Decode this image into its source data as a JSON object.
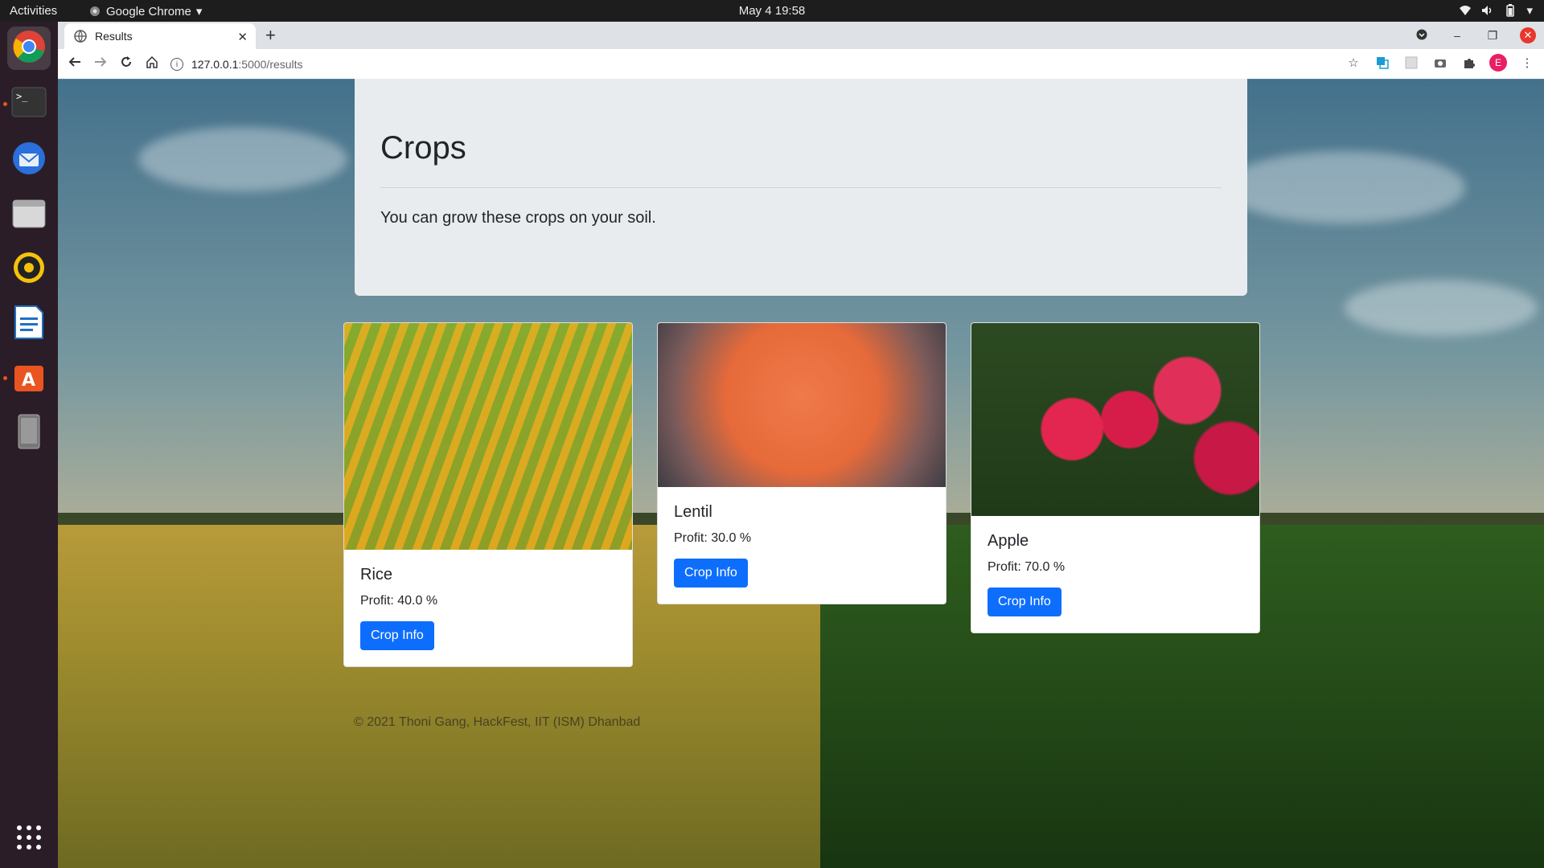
{
  "topbar": {
    "activities": "Activities",
    "app_name": "Google Chrome",
    "clock": "May 4  19:58"
  },
  "dock": {
    "items": [
      "chrome-icon",
      "terminal-icon",
      "thunderbird-icon",
      "files-icon",
      "rhythmbox-icon",
      "writer-icon",
      "software-icon",
      "device-icon",
      "app-grid-icon"
    ]
  },
  "browser": {
    "tab_title": "Results",
    "url_host": "127.0.0.1",
    "url_path": ":5000/results",
    "profile_initial": "E"
  },
  "jumbotron": {
    "title": "Crops",
    "lead": "You can grow these crops on your soil."
  },
  "crops": [
    {
      "name": "Rice",
      "profit": "Profit: 40.0 %",
      "button": "Crop Info"
    },
    {
      "name": "Lentil",
      "profit": "Profit: 30.0 %",
      "button": "Crop Info"
    },
    {
      "name": "Apple",
      "profit": "Profit: 70.0 %",
      "button": "Crop Info"
    }
  ],
  "footer": "© 2021 Thoni Gang, HackFest, IIT (ISM) Dhanbad"
}
